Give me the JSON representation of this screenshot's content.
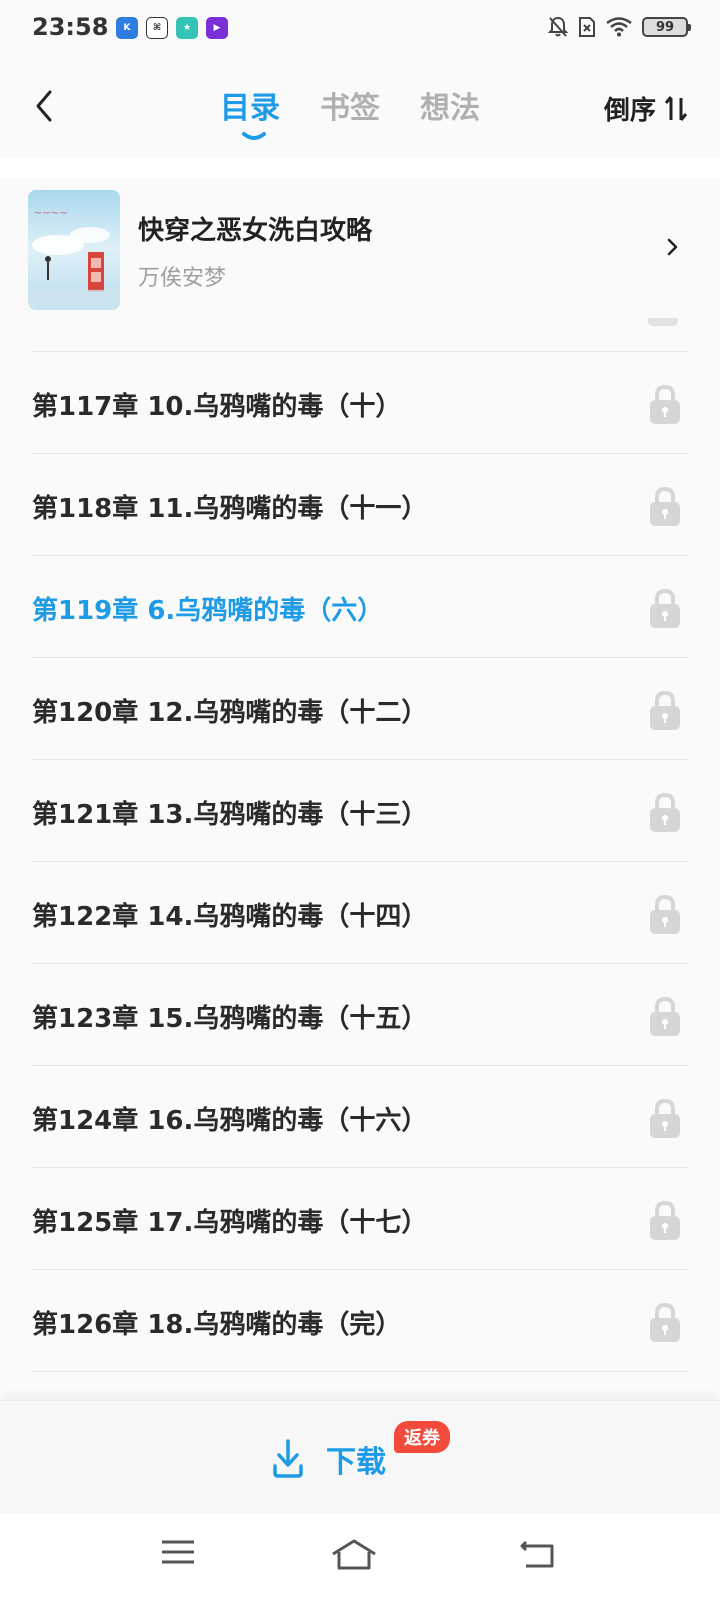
{
  "status_bar": {
    "time": "23:58",
    "apps": [
      {
        "icon": "kuwo-app-icon",
        "label": "K",
        "color": "#2f7de1"
      },
      {
        "icon": "baidu-app-icon",
        "label": "⌘",
        "color": "#ffffff"
      },
      {
        "icon": "game-app-icon",
        "label": "★",
        "color": "#34c3b5"
      },
      {
        "icon": "video-app-icon",
        "label": "▶",
        "color": "#7b2fd6"
      }
    ],
    "battery": "99"
  },
  "nav": {
    "tabs": [
      {
        "label": "目录",
        "active": true
      },
      {
        "label": "书签",
        "active": false
      },
      {
        "label": "想法",
        "active": false
      }
    ],
    "sort_label": "倒序"
  },
  "book": {
    "title": "快穿之恶女洗白攻略",
    "author": "万俟安梦"
  },
  "chapters": [
    {
      "title": "第117章 10.乌鸦嘴的毒（十）",
      "locked": true,
      "current": false
    },
    {
      "title": "第118章 11.乌鸦嘴的毒（十一）",
      "locked": true,
      "current": false
    },
    {
      "title": "第119章 6.乌鸦嘴的毒（六）",
      "locked": true,
      "current": true
    },
    {
      "title": "第120章 12.乌鸦嘴的毒（十二）",
      "locked": true,
      "current": false
    },
    {
      "title": "第121章 13.乌鸦嘴的毒（十三）",
      "locked": true,
      "current": false
    },
    {
      "title": "第122章 14.乌鸦嘴的毒（十四）",
      "locked": true,
      "current": false
    },
    {
      "title": "第123章 15.乌鸦嘴的毒（十五）",
      "locked": true,
      "current": false
    },
    {
      "title": "第124章 16.乌鸦嘴的毒（十六）",
      "locked": true,
      "current": false
    },
    {
      "title": "第125章 17.乌鸦嘴的毒（十七）",
      "locked": true,
      "current": false
    },
    {
      "title": "第126章 18.乌鸦嘴的毒（完）",
      "locked": true,
      "current": false
    }
  ],
  "bottom": {
    "download_label": "下载",
    "coupon_badge": "返券"
  },
  "colors": {
    "accent": "#1e9be6",
    "badge": "#f24b3c",
    "lock": "#d6d6d6"
  }
}
